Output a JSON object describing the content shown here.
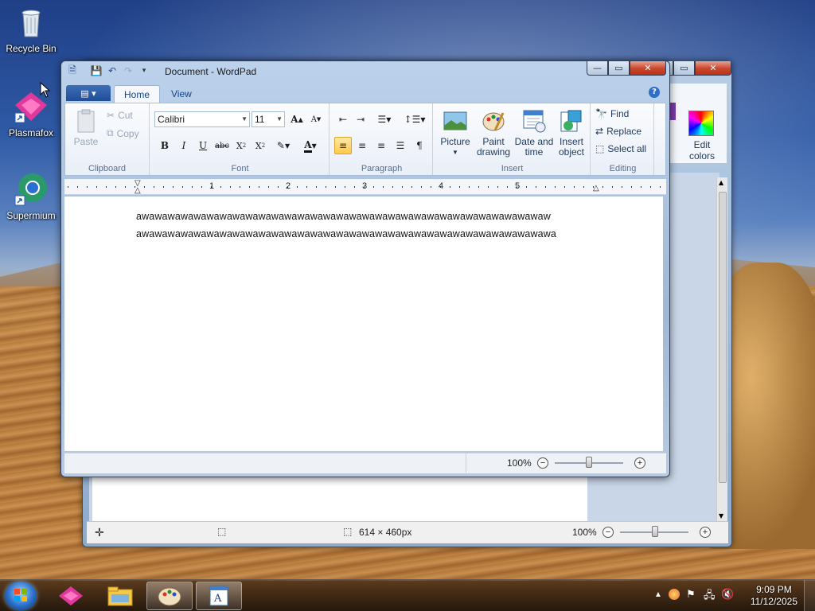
{
  "desktop": {
    "icons": [
      {
        "label": "Recycle Bin"
      },
      {
        "label": "Plasmafox"
      },
      {
        "label": "Supermium"
      }
    ]
  },
  "paint_window": {
    "ribbon_right_label": "Edit colors",
    "status": {
      "size": "614 × 460px",
      "zoom": "100%"
    }
  },
  "wordpad": {
    "title": "Document - WordPad",
    "tabs": [
      {
        "label": "Home",
        "active": true
      },
      {
        "label": "View",
        "active": false
      }
    ],
    "clipboard": {
      "group_label": "Clipboard",
      "paste": "Paste",
      "cut": "Cut",
      "copy": "Copy"
    },
    "font": {
      "group_label": "Font",
      "family": "Calibri",
      "size": "11"
    },
    "paragraph": {
      "group_label": "Paragraph"
    },
    "insert": {
      "group_label": "Insert",
      "picture": "Picture",
      "paint_drawing_1": "Paint",
      "paint_drawing_2": "drawing",
      "date_time_1": "Date and",
      "date_time_2": "time",
      "insert_object_1": "Insert",
      "insert_object_2": "object"
    },
    "editing": {
      "group_label": "Editing",
      "find": "Find",
      "replace": "Replace",
      "select_all": "Select all"
    },
    "ruler_numbers": [
      "1",
      "2",
      "3",
      "4",
      "5"
    ],
    "document_lines": [
      "awawawawawawawawawawawawawawawawawawawawawawawawawawawawawawawaw",
      "awawawawawawawawawawawawawawawawawawawawawawawawawawawawawawawawa"
    ],
    "status": {
      "zoom": "100%",
      "zoom_level": 1.0
    }
  },
  "taskbar": {
    "clock_time": "9:09 PM",
    "clock_date": "11/12/2025"
  },
  "colors": {
    "accent": "#1f4d97",
    "close_red": "#c8452b"
  }
}
